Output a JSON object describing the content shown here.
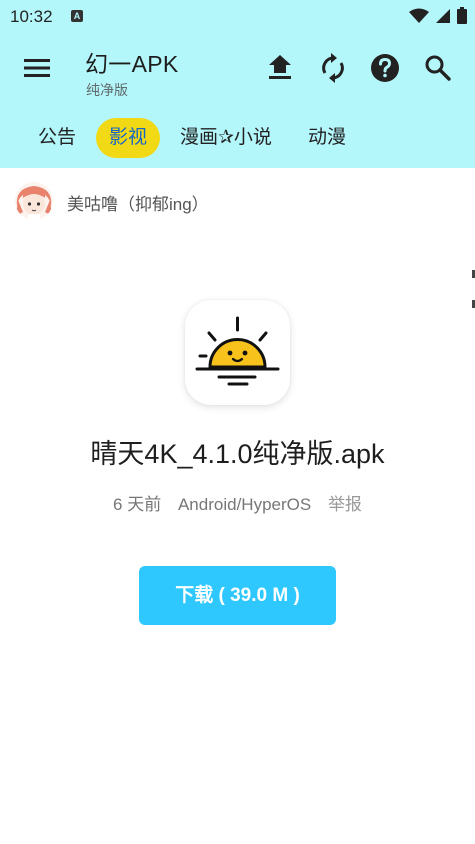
{
  "status_bar": {
    "time": "10:32",
    "notification_icon": "a-icon",
    "icons": [
      "wifi-icon",
      "signal-icon",
      "battery-icon"
    ]
  },
  "app_bar": {
    "title": "幻一APK",
    "subtitle": "纯净版",
    "actions": [
      "upload-icon",
      "refresh-icon",
      "help-icon",
      "search-icon"
    ],
    "colors": {
      "background": "#b4f7fb",
      "active_tab_bg": "#f1d915",
      "active_tab_text": "#1766c6"
    }
  },
  "tabs": [
    {
      "label": "公告",
      "active": false
    },
    {
      "label": "影视",
      "active": true
    },
    {
      "label": "漫画✰小说",
      "active": false
    },
    {
      "label": "动漫",
      "active": false
    }
  ],
  "author": {
    "name": "美咕噜（抑郁ing）"
  },
  "item": {
    "file_name": "晴天4K_4.1.0纯净版.apk",
    "time_ago": "6 天前",
    "platform": "Android/HyperOS",
    "report_label": "举报",
    "download_label": "下载 ( 39.0 M )",
    "download_color": "#2ec8ff"
  }
}
